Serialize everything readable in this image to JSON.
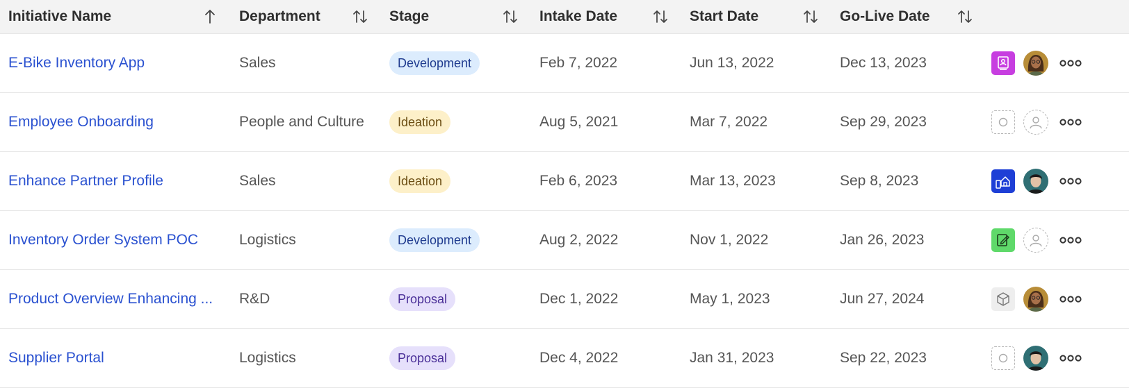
{
  "table": {
    "columns": [
      {
        "label": "Initiative Name",
        "sort": "ascending"
      },
      {
        "label": "Department",
        "sort": "none"
      },
      {
        "label": "Stage",
        "sort": "none"
      },
      {
        "label": "Intake Date",
        "sort": "none"
      },
      {
        "label": "Start Date",
        "sort": "none"
      },
      {
        "label": "Go-Live Date",
        "sort": "none"
      }
    ],
    "rows": [
      {
        "name": "E-Bike Inventory App",
        "department": "Sales",
        "stage": "Development",
        "intake": "Feb 7, 2022",
        "start": "Jun 13, 2022",
        "golive": "Dec 13, 2023",
        "app_icon": "contact-book-icon",
        "app_color": "#c73ee0",
        "owner": "woman-avatar"
      },
      {
        "name": "Employee Onboarding",
        "department": "People and Culture",
        "stage": "Ideation",
        "intake": "Aug 5, 2021",
        "start": "Mar 7, 2022",
        "golive": "Sep 29, 2023",
        "app_icon": "empty",
        "app_color": "#ffffff",
        "owner": "empty"
      },
      {
        "name": "Enhance Partner Profile",
        "department": "Sales",
        "stage": "Ideation",
        "intake": "Feb 6, 2023",
        "start": "Mar 13, 2023",
        "golive": "Sep 8, 2023",
        "app_icon": "house-phone-icon",
        "app_color": "#1e3fd6",
        "owner": "man-avatar"
      },
      {
        "name": "Inventory Order System POC",
        "department": "Logistics",
        "stage": "Development",
        "intake": "Aug 2, 2022",
        "start": "Nov 1, 2022",
        "golive": "Jan 26, 2023",
        "app_icon": "edit-document-icon",
        "app_color": "#5fd96a",
        "owner": "empty"
      },
      {
        "name": "Product Overview Enhancing ...",
        "department": "R&D",
        "stage": "Proposal",
        "intake": "Dec 1, 2022",
        "start": "May 1, 2023",
        "golive": "Jun 27, 2024",
        "app_icon": "cube-icon",
        "app_color": "#eeeeee",
        "owner": "woman-avatar"
      },
      {
        "name": "Supplier Portal",
        "department": "Logistics",
        "stage": "Proposal",
        "intake": "Dec 4, 2022",
        "start": "Jan 31, 2023",
        "golive": "Sep 22, 2023",
        "app_icon": "empty",
        "app_color": "#ffffff",
        "owner": "man-avatar"
      }
    ]
  },
  "stage_colors": {
    "Development": {
      "bg": "#dcecfd",
      "fg": "#1f3b8f"
    },
    "Ideation": {
      "bg": "#fdf0c9",
      "fg": "#6b4d12"
    },
    "Proposal": {
      "bg": "#e6e0fb",
      "fg": "#4a2f98"
    }
  },
  "colors": {
    "link": "#2a51d0",
    "header_bg": "#f3f3f3"
  }
}
